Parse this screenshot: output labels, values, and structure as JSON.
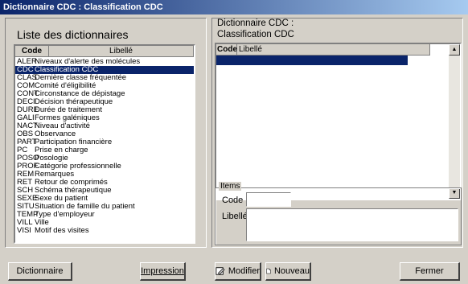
{
  "window": {
    "title": "Dictionnaire CDC : Classification CDC"
  },
  "left": {
    "heading": "Liste des dictionnaires",
    "columns": {
      "code": "Code",
      "libelle": "Libellé"
    },
    "rows": [
      {
        "code": "ALER",
        "label": "Niveaux d'alerte des molécules"
      },
      {
        "code": "CDC",
        "label": "Classification CDC"
      },
      {
        "code": "CLAS",
        "label": "Dernière classe fréquentée"
      },
      {
        "code": "COM",
        "label": "Comité d'éligibilité"
      },
      {
        "code": "CONT",
        "label": "Circonstance de dépistage"
      },
      {
        "code": "DECI",
        "label": "Décision thérapeutique"
      },
      {
        "code": "DURE",
        "label": "Durée de traitement"
      },
      {
        "code": "GALI",
        "label": "Formes galéniques"
      },
      {
        "code": "NACT",
        "label": "Niveau d'activité"
      },
      {
        "code": "OBS",
        "label": "Observance"
      },
      {
        "code": "PART",
        "label": "Participation financière"
      },
      {
        "code": "PC",
        "label": "Prise en charge"
      },
      {
        "code": "POSO",
        "label": "Posologie"
      },
      {
        "code": "PROF",
        "label": "Catégorie professionnelle"
      },
      {
        "code": "REM",
        "label": "Remarques"
      },
      {
        "code": "RET",
        "label": "Retour de comprimés"
      },
      {
        "code": "SCH",
        "label": "Schéma thérapeutique"
      },
      {
        "code": "SEXE",
        "label": "Sexe du patient"
      },
      {
        "code": "SITU",
        "label": "Situation de famille du patient"
      },
      {
        "code": "TEMP",
        "label": "Type d'employeur"
      },
      {
        "code": "VILL",
        "label": "Ville"
      },
      {
        "code": "VISI",
        "label": "Motif des visites"
      }
    ],
    "selected_index": 1
  },
  "right": {
    "heading_line1": "Dictionnaire CDC :",
    "heading_line2": "Classification CDC",
    "columns": {
      "code": "Code",
      "libelle": "Libellé"
    },
    "items_group": {
      "title": "Items",
      "code_label": "Code",
      "libelle_label": "Libellé",
      "code_value": "",
      "libelle_value": ""
    }
  },
  "buttons": {
    "dictionnaire": "Dictionnaire",
    "impression": "Impression",
    "modifier": "Modifier",
    "nouveau": "Nouveau",
    "fermer": "Fermer"
  },
  "icons": {
    "modifier": "edit-icon",
    "nouveau": "new-document-icon",
    "scroll_up": "arrow-up-icon",
    "scroll_down": "arrow-down-icon"
  }
}
